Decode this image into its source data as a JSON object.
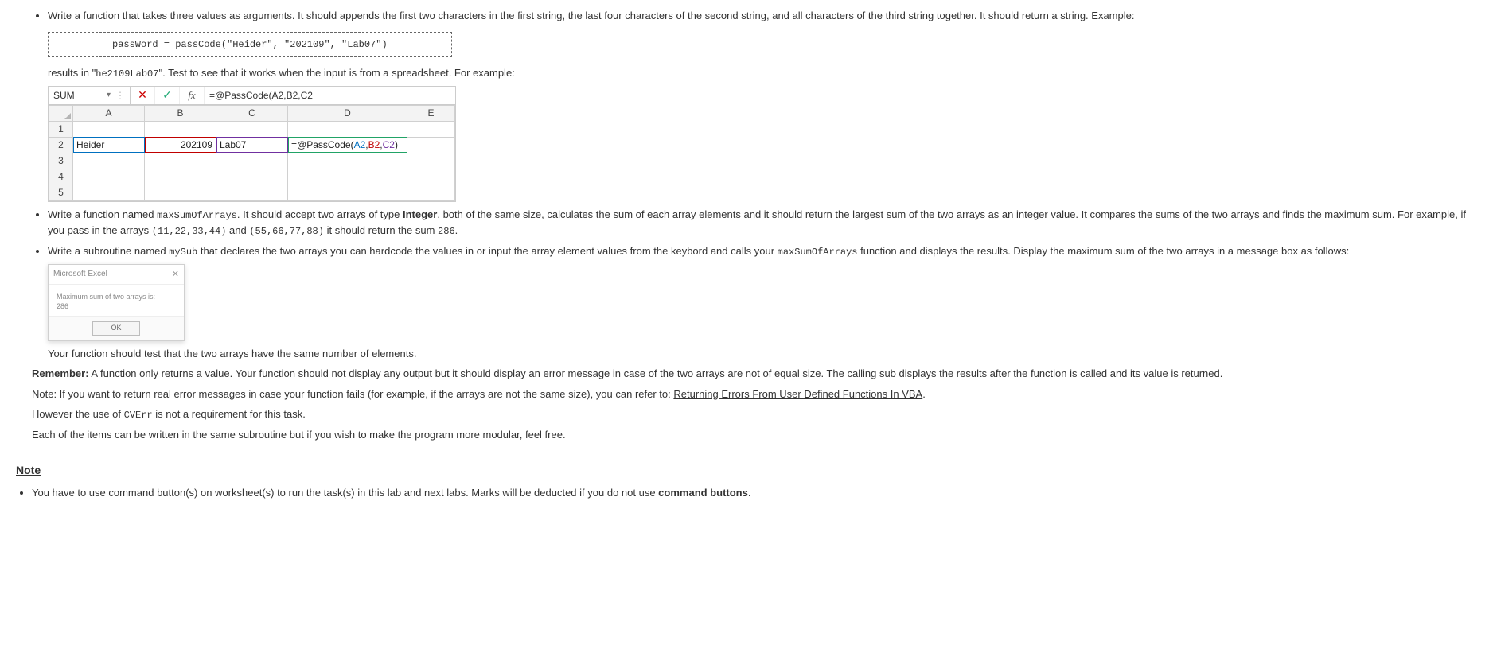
{
  "item1": {
    "text": "Write a function that takes three values as arguments. It should appends the first two characters in the first string, the last four characters of the second string, and all characters of the third string together. It should return a string. Example:",
    "code": "passWord = passCode(\"Heider\", \"202109\", \"Lab07\")",
    "results_prefix": "results in \"",
    "results_code": "he2109Lab07",
    "results_suffix": "\". Test to see that it works when the input is from a spreadsheet. For example:"
  },
  "excel": {
    "namebox": "SUM",
    "bar_cancel": "✕",
    "bar_accept": "✓",
    "bar_fx": "fx",
    "formula_plain": "=@PassCode(A2,B2,C2",
    "cols": {
      "A": "A",
      "B": "B",
      "C": "C",
      "D": "D",
      "E": "E"
    },
    "rows": {
      "1": "1",
      "2": "2",
      "3": "3",
      "4": "4",
      "5": "5"
    },
    "cells": {
      "A2": "Heider",
      "B2": "202109",
      "C2": "Lab07",
      "D2_pre": "=@PassCode(",
      "D2_a": "A2",
      "D2_c1": ",",
      "D2_b": "B2",
      "D2_c2": ",",
      "D2_c": "C2",
      "D2_post": ")"
    }
  },
  "item2": {
    "p1_a": "Write a function named ",
    "p1_code1": "maxSumOfArrays",
    "p1_b": ". It should accept two arrays of type ",
    "p1_bold1": "Integer",
    "p1_c": ", both of the same size, calculates the sum of each array elements and it should return the largest sum of the two arrays as an integer value. It compares the sums of the two arrays and finds the maximum sum. For example, if you pass in the arrays ",
    "p1_code2": "(11,22,33,44)",
    "p1_d": " and ",
    "p1_code3": "(55,66,77,88)",
    "p1_e": " it should return the sum ",
    "p1_code4": "286",
    "p1_f": "."
  },
  "item3": {
    "a": "Write a subroutine named ",
    "code1": "mySub",
    "b": " that declares the two arrays you can hardcode the values in or input the array element values from the keybord and calls your ",
    "code2": "maxSumOfArrays",
    "c": " function and displays the results. Display the maximum sum of the two arrays in a message box as follows:"
  },
  "msgbox": {
    "title": "Microsoft Excel",
    "close": "✕",
    "line1": "Maximum sum of two arrays is:",
    "line2": "286",
    "ok": "OK"
  },
  "after_msg": "Your function should test that the two arrays have the same number of elements.",
  "remember": {
    "label": "Remember:",
    "text": " A function only returns a value. Your function should not display any output but it should display an error message in case of the two arrays are not of equal size. The calling sub displays the results after the function is called and its value is returned."
  },
  "note1": {
    "a": "Note: If you want to return real error messages in case your function fails (for example, if the arrays are not the same size), you can refer to: ",
    "link": "Returning Errors From User Defined Functions In VBA",
    "b": "."
  },
  "note2": {
    "a": "However the use of ",
    "code": "CVErr",
    "b": " is not a requirement for this task."
  },
  "note3": "Each of the items can be written in the same subroutine but if you wish to make the program more modular, feel free.",
  "note_head": "Note",
  "bottom": {
    "a": "You have to use command button(s) on worksheet(s) to run the task(s) in this lab and next labs. Marks will be deducted if you do not use ",
    "bold": "command buttons",
    "b": "."
  }
}
